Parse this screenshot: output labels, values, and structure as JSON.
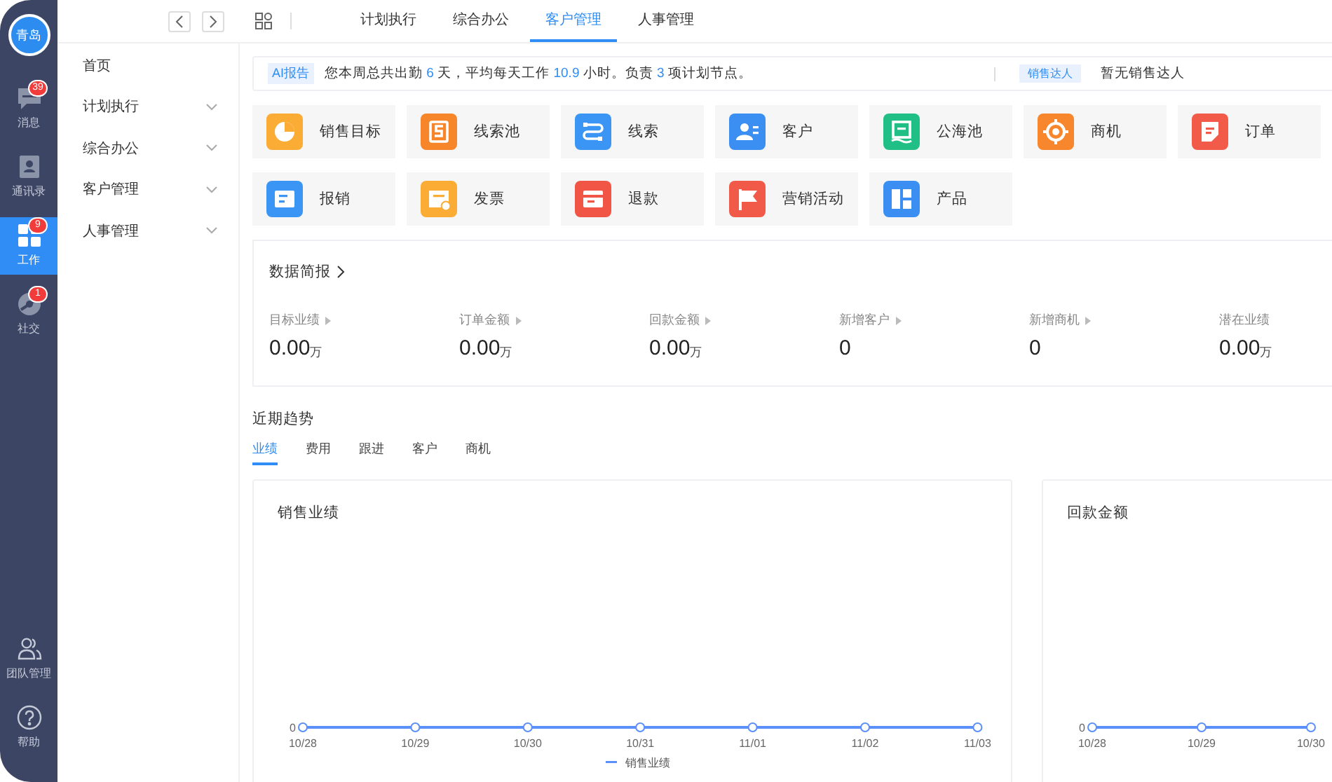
{
  "rail": {
    "avatar": "青岛",
    "items": [
      {
        "label": "消息",
        "badge": "39",
        "selected": false
      },
      {
        "label": "通讯录",
        "selected": false
      },
      {
        "label": "工作",
        "badge": "9",
        "selected": true
      },
      {
        "label": "社交",
        "badge": "1",
        "selected": false
      }
    ],
    "bottom_items": [
      {
        "label": "团队管理"
      },
      {
        "label": "帮助"
      }
    ]
  },
  "top_tabs": [
    {
      "label": "计划执行",
      "selected": false
    },
    {
      "label": "综合办公",
      "selected": false
    },
    {
      "label": "客户管理",
      "selected": true
    },
    {
      "label": "人事管理",
      "selected": false
    }
  ],
  "sidebar": {
    "items": [
      {
        "label": "首页",
        "expandable": false
      },
      {
        "label": "计划执行",
        "expandable": true
      },
      {
        "label": "综合办公",
        "expandable": true
      },
      {
        "label": "客户管理",
        "expandable": true
      },
      {
        "label": "人事管理",
        "expandable": true
      }
    ]
  },
  "banner": {
    "tag": "AI报告",
    "segments": [
      {
        "text": "您本周总共出勤 ",
        "highlight": false
      },
      {
        "text": "6",
        "highlight": true
      },
      {
        "text": " 天，平均每天工作 ",
        "highlight": false
      },
      {
        "text": "10.9",
        "highlight": true
      },
      {
        "text": " 小时。负责 ",
        "highlight": false
      },
      {
        "text": "3",
        "highlight": true
      },
      {
        "text": " 项计划节点。",
        "highlight": false
      }
    ],
    "star_tag": "销售达人",
    "star_text": "暂无销售达人"
  },
  "shortcuts": [
    {
      "label": "销售目标",
      "color": "#fbac35"
    },
    {
      "label": "线索池",
      "color": "#f7862a"
    },
    {
      "label": "线索",
      "color": "#3b95f4"
    },
    {
      "label": "客户",
      "color": "#3b8ff2"
    },
    {
      "label": "公海池",
      "color": "#1fbf86"
    },
    {
      "label": "商机",
      "color": "#f8862c"
    },
    {
      "label": "订单",
      "color": "#f25a4a"
    },
    {
      "label": "报销",
      "color": "#3b95f4"
    },
    {
      "label": "发票",
      "color": "#fbac35"
    },
    {
      "label": "退款",
      "color": "#f05545"
    },
    {
      "label": "营销活动",
      "color": "#f15a49"
    },
    {
      "label": "产品",
      "color": "#3b8ff2"
    }
  ],
  "briefing": {
    "title": "数据简报",
    "stats": [
      {
        "label": "目标业绩",
        "value": "0.00",
        "unit": "万",
        "drilldown": true
      },
      {
        "label": "订单金额",
        "value": "0.00",
        "unit": "万",
        "drilldown": true
      },
      {
        "label": "回款金额",
        "value": "0.00",
        "unit": "万",
        "drilldown": true
      },
      {
        "label": "新增客户",
        "value": "0",
        "drilldown": true
      },
      {
        "label": "新增商机",
        "value": "0",
        "drilldown": true
      },
      {
        "label": "潜在业绩",
        "value": "0.00",
        "unit": "万",
        "drilldown": false
      }
    ]
  },
  "trends": {
    "title": "近期趋势",
    "tabs": [
      {
        "label": "业绩",
        "selected": true
      },
      {
        "label": "费用",
        "selected": false
      },
      {
        "label": "跟进",
        "selected": false
      },
      {
        "label": "客户",
        "selected": false
      },
      {
        "label": "商机",
        "selected": false
      }
    ],
    "charts": [
      {
        "title": "销售业绩",
        "axis_text": "0",
        "x_labels": [
          "10/28",
          "10/29",
          "10/30",
          "10/31",
          "11/01",
          "11/02",
          "11/03"
        ],
        "legend": "销售业绩"
      },
      {
        "title": "回款金额",
        "axis_text": "0",
        "x_labels": [
          "10/28",
          "10/29",
          "10/30"
        ]
      }
    ]
  }
}
